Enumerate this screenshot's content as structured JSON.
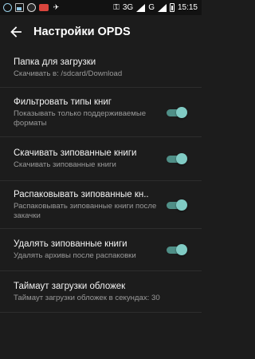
{
  "status_bar": {
    "network_label": "3G",
    "carrier_label": "G",
    "time": "15:15",
    "notification_badge": "24"
  },
  "header": {
    "title": "Настройки OPDS"
  },
  "settings": [
    {
      "title": "Папка для загрузки",
      "subtitle": "Скачивать в: /sdcard/Download",
      "toggle": null
    },
    {
      "title": "Фильтровать типы книг",
      "subtitle": "Показывать только поддерживаемые форматы",
      "toggle": true
    },
    {
      "title": "Скачивать зипованные книги",
      "subtitle": "Скачивать зипованные книги",
      "toggle": true
    },
    {
      "title": "Распаковывать зипованные кн..",
      "subtitle": "Распаковывать зипованные книги после закачки",
      "toggle": true
    },
    {
      "title": "Удалять зипованные книги",
      "subtitle": "Удалять архивы после распаковки",
      "toggle": true
    },
    {
      "title": "Таймаут загрузки обложек",
      "subtitle": "Таймаут загрузки обложек в секундах: 30",
      "toggle": null
    }
  ],
  "colors": {
    "background": "#1c1c1c",
    "accent": "#80cbc4",
    "divider": "#2d2d2d"
  }
}
